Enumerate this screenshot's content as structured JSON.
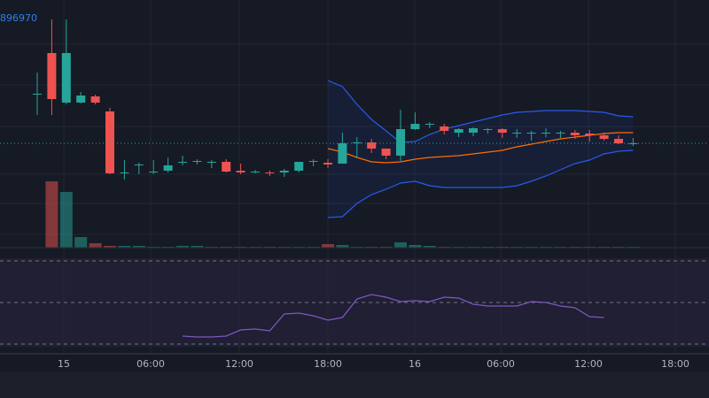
{
  "colors": {
    "background": "#161a25",
    "up": "#26a69a",
    "down": "#ef5350",
    "bb_band": "#2962ff",
    "bb_basis": "#ff6d00",
    "rsi_line": "#7e57c2",
    "rsi_fill": "#2a2440",
    "grid": "#232734",
    "price_line": "#26a69a",
    "axis_text": "#b2b5be",
    "price_label": "#2f80ed"
  },
  "header": {
    "price_label": "896970"
  },
  "chart_data": [
    {
      "type": "candlestick",
      "title": "",
      "x": [
        "14:00",
        "15",
        "02:00",
        "03:00",
        "04:00",
        "05:00",
        "06:00",
        "07:00",
        "08:00",
        "09:00",
        "10:00",
        "11:00",
        "12:00",
        "13:00",
        "14:00",
        "15:00",
        "16:00",
        "17:00",
        "18:00",
        "19:00",
        "20:00",
        "21:00",
        "22:00",
        "23:00",
        "16",
        "01:00",
        "02:00",
        "03:00",
        "04:00",
        "05:00",
        "06:00",
        "07:00",
        "08:00",
        "09:00",
        "10:00",
        "11:00",
        "12:00",
        "13:00",
        "14:00",
        "15:00",
        "16:00",
        "17:00"
      ],
      "x_ticks": [
        "15",
        "06:00",
        "12:00",
        "18:00",
        "16",
        "06:00",
        "12:00",
        "18:00"
      ],
      "open": [
        106,
        60,
        116,
        116,
        109,
        126,
        195,
        186,
        194,
        193,
        184,
        182,
        183,
        183,
        193,
        194,
        195,
        195,
        193,
        183,
        184,
        185,
        162,
        161,
        168,
        176,
        146,
        140,
        143,
        150,
        150,
        146,
        146,
        150,
        151,
        151,
        151,
        150,
        151,
        153,
        157,
        162
      ],
      "close": [
        106,
        112,
        60,
        108,
        116,
        196,
        195,
        186,
        194,
        187,
        183,
        182,
        183,
        194,
        195,
        194,
        196,
        193,
        183,
        182,
        186,
        162,
        161,
        168,
        176,
        146,
        140,
        140,
        148,
        146,
        145,
        146,
        150,
        150,
        150,
        150,
        150,
        153,
        153,
        157,
        162,
        162
      ],
      "high": [
        82,
        22,
        22,
        104,
        107,
        122,
        181,
        184,
        181,
        178,
        176,
        180,
        181,
        180,
        185,
        192,
        193,
        191,
        183,
        180,
        180,
        150,
        155,
        157,
        168,
        124,
        127,
        138,
        140,
        145,
        144,
        145,
        145,
        146,
        148,
        145,
        148,
        147,
        147,
        150,
        153,
        156
      ],
      "low": [
        130,
        130,
        118,
        117,
        118,
        197,
        203,
        197,
        197,
        195,
        187,
        186,
        190,
        195,
        197,
        196,
        199,
        200,
        195,
        188,
        190,
        183,
        179,
        173,
        180,
        182,
        147,
        145,
        152,
        155,
        154,
        151,
        156,
        156,
        159,
        155,
        156,
        157,
        160,
        159,
        163,
        165
      ],
      "volume": [
        0,
        75,
        63,
        12,
        5,
        2,
        2,
        2,
        1,
        1,
        2,
        2,
        1,
        1,
        1,
        1,
        1,
        1,
        1,
        1,
        4,
        3,
        1,
        1,
        1,
        6,
        3,
        2,
        1,
        1,
        1,
        1,
        1,
        1,
        1,
        1,
        1,
        1,
        1,
        1,
        1,
        1
      ],
      "bollinger": {
        "start_index": 20,
        "upper": [
          91,
          98,
          118,
          135,
          148,
          161,
          160,
          152,
          146,
          142,
          138,
          134,
          130,
          127,
          126,
          125,
          125,
          125,
          126,
          127,
          131,
          132
        ],
        "basis": [
          168,
          172,
          178,
          183,
          184,
          183,
          180,
          178,
          177,
          176,
          174,
          172,
          170,
          166,
          163,
          160,
          157,
          155,
          153,
          151,
          150,
          150
        ],
        "lower": [
          246,
          245,
          230,
          220,
          214,
          207,
          205,
          210,
          212,
          212,
          212,
          212,
          212,
          210,
          205,
          199,
          192,
          185,
          181,
          174,
          171,
          170
        ]
      },
      "last_price": 162
    },
    {
      "type": "line",
      "title": "",
      "name": "",
      "start_index": 10,
      "x": [
        "12:00",
        "13:00",
        "14:00",
        "15:00",
        "16:00",
        "17:00",
        "18:00",
        "19:00",
        "20:00",
        "21:00",
        "22:00",
        "23:00",
        "16",
        "01:00",
        "02:00",
        "03:00",
        "04:00",
        "05:00",
        "06:00",
        "07:00",
        "08:00",
        "09:00",
        "10:00",
        "11:00",
        "12:00",
        "13:00",
        "14:00",
        "15:00",
        "16:00",
        "17:00"
      ],
      "values": [
        380,
        381,
        381,
        380,
        373,
        372,
        374,
        355,
        354,
        357,
        362,
        359,
        338,
        333,
        336,
        341,
        340,
        341,
        336,
        337,
        344,
        346,
        346,
        346,
        341,
        342,
        346,
        348,
        358,
        359
      ],
      "levels": [
        295,
        342,
        389
      ],
      "ylim": [
        290,
        395
      ]
    }
  ]
}
